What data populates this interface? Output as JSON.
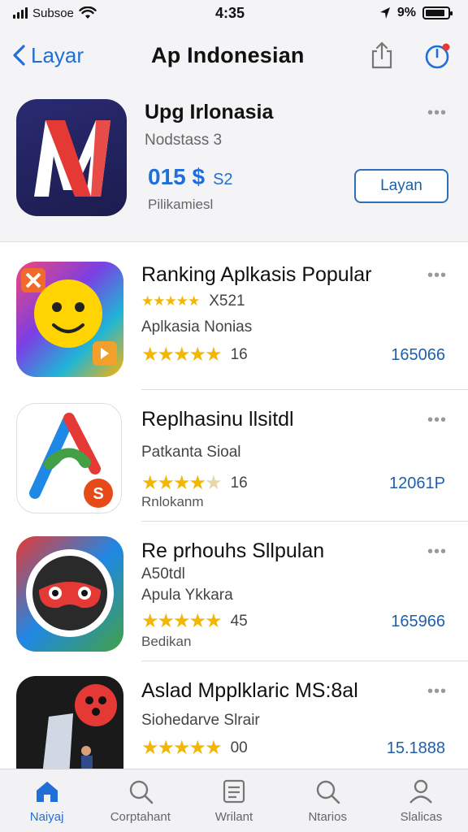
{
  "status_bar": {
    "carrier": "Subsoe",
    "time": "4:35",
    "battery": "9%",
    "battery_level": 0.9
  },
  "nav": {
    "back_label": "Layar",
    "title": "Ap Indonesian"
  },
  "featured": {
    "name": "Upg Irlonasia",
    "subtitle": "Nodstass 3",
    "price": "015 $",
    "price_small": "S2",
    "category": "Pilikamiesl",
    "get_label": "Layan",
    "more": "•••"
  },
  "apps": [
    {
      "title": "Ranking Aplkasis Popular",
      "line1_stars_value": "X521",
      "line2": "Aplkasia Nonias",
      "rating": 5,
      "rating_label": "16",
      "count": "165066",
      "more": "•••"
    },
    {
      "title": "Replhasinu llsitdl",
      "line2": "Patkanta Sioal",
      "rating": 4.5,
      "rating_label": "16",
      "count": "12061P",
      "line3": "Rnlokanm",
      "more": "•••"
    },
    {
      "title": "Re prhouhs Sllpulan",
      "line1": "A50tdl",
      "line2": "Apula Ykkara",
      "rating": 5,
      "rating_label": "45",
      "count": "165966",
      "line3": "Bedikan",
      "more": "•••"
    },
    {
      "title": "Aslad Mpplklaric MS:8al",
      "line2": "Siohedarve Slrair",
      "rating": 5,
      "rating_label": "00",
      "count": "15.1888",
      "more": "•••"
    }
  ],
  "tabs": [
    {
      "label": "Naiyaj",
      "icon": "home-icon",
      "active": true
    },
    {
      "label": "Corptahant",
      "icon": "search-icon",
      "active": false
    },
    {
      "label": "Wrilant",
      "icon": "list-icon",
      "active": false
    },
    {
      "label": "Ntarios",
      "icon": "search-icon",
      "active": false
    },
    {
      "label": "Slalicas",
      "icon": "person-icon",
      "active": false
    }
  ]
}
